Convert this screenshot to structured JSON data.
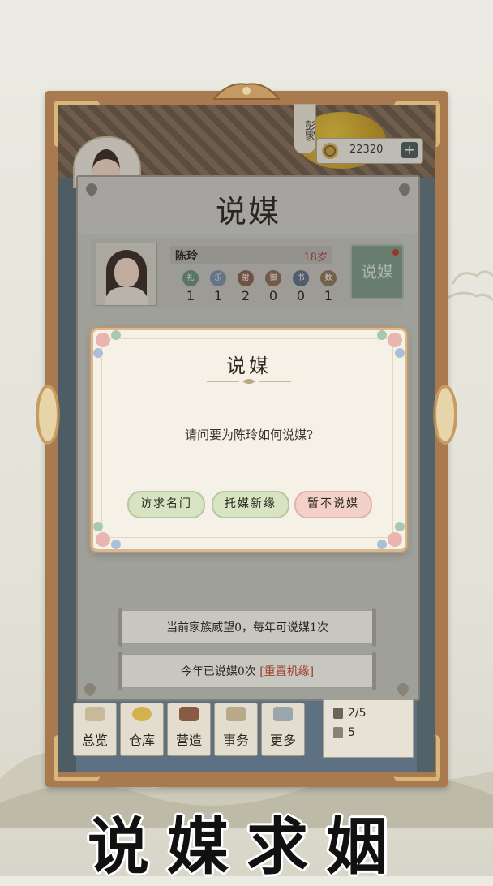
{
  "family": {
    "name": "彭家"
  },
  "currency": {
    "amount": "22320",
    "add_label": "+"
  },
  "panel": {
    "title": "说媒"
  },
  "character": {
    "name": "陈玲",
    "age": "18岁",
    "stats": [
      {
        "icon": "礼",
        "value": "1",
        "color": "#6c8f7a"
      },
      {
        "icon": "乐",
        "value": "1",
        "color": "#7b8fa4"
      },
      {
        "icon": "射",
        "value": "2",
        "color": "#8a5f4c"
      },
      {
        "icon": "御",
        "value": "0",
        "color": "#8e6a50"
      },
      {
        "icon": "书",
        "value": "0",
        "color": "#5d6f86"
      },
      {
        "icon": "数",
        "value": "1",
        "color": "#8c7656"
      }
    ],
    "match_button": "说媒"
  },
  "dialog": {
    "title": "说媒",
    "question": "请问要为陈玲如何说媒?",
    "options": [
      "访求名门",
      "托媒新缘",
      "暂不说媒"
    ]
  },
  "info": {
    "prestige_text": "当前家族威望0，每年可说媒1次",
    "count_text": "今年已说媒0次",
    "reset_link": "[重置机缘]"
  },
  "nav": [
    "总览",
    "仓库",
    "营造",
    "事务",
    "更多"
  ],
  "resources": {
    "people": "2/5",
    "energy": "5"
  },
  "slogan": "说媒求姻",
  "colors": {
    "frame": "#a97a4f",
    "accent_red": "#a1412f",
    "button_green": "#d6e4c2"
  }
}
